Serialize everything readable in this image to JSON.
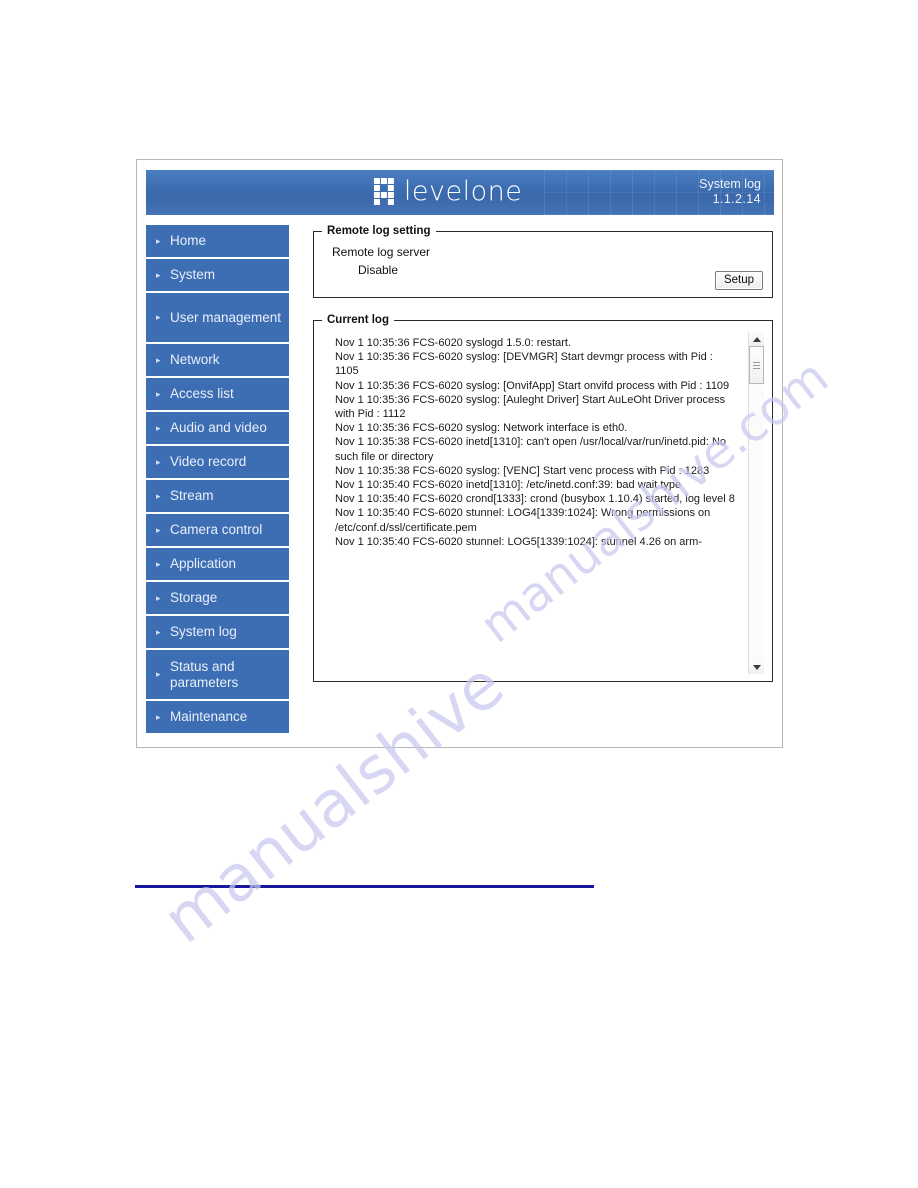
{
  "banner": {
    "logo_word": "levelone",
    "logo_icon": "levelone-grid-logo",
    "title": "System log",
    "version": "1.1.2.14"
  },
  "sidebar": {
    "items": [
      {
        "label": "Home"
      },
      {
        "label": "System"
      },
      {
        "label": "User management"
      },
      {
        "label": "Network"
      },
      {
        "label": "Access list"
      },
      {
        "label": "Audio and video"
      },
      {
        "label": "Video record"
      },
      {
        "label": "Stream"
      },
      {
        "label": "Camera control"
      },
      {
        "label": "Application"
      },
      {
        "label": "Storage"
      },
      {
        "label": "System log"
      },
      {
        "label": "Status and parameters"
      },
      {
        "label": "Maintenance"
      }
    ]
  },
  "remote_log": {
    "legend": "Remote log setting",
    "server_label": "Remote log server",
    "server_value": "Disable",
    "setup_button": "Setup"
  },
  "current_log": {
    "legend": "Current log",
    "text": "Nov 1 10:35:36 FCS-6020 syslogd 1.5.0: restart.\nNov 1 10:35:36 FCS-6020 syslog: [DEVMGR] Start devmgr process with Pid : 1105\nNov 1 10:35:36 FCS-6020 syslog: [OnvifApp] Start onvifd process with Pid : 1109\nNov 1 10:35:36 FCS-6020 syslog: [Auleght Driver] Start AuLeOht Driver process with Pid : 1112\nNov 1 10:35:36 FCS-6020 syslog: Network interface is eth0.\nNov 1 10:35:38 FCS-6020 inetd[1310]: can't open /usr/local/var/run/inetd.pid: No such file or directory\nNov 1 10:35:38 FCS-6020 syslog: [VENC] Start venc process with Pid : 1283\nNov 1 10:35:40 FCS-6020 inetd[1310]: /etc/inetd.conf:39: bad wait type\nNov 1 10:35:40 FCS-6020 crond[1333]: crond (busybox 1.10.4) started, log level 8\nNov 1 10:35:40 FCS-6020 stunnel: LOG4[1339:1024]: Wrong permissions on /etc/conf.d/ssl/certificate.pem\nNov 1 10:35:40 FCS-6020 stunnel: LOG5[1339:1024]: stunnel 4.26 on arm-",
    "scrollbar": {
      "up_arrow": "scroll-up-arrow",
      "down_arrow": "scroll-down-arrow"
    }
  },
  "watermark": {
    "line_a": "manualshive",
    "line_b": "manualshive.com"
  },
  "colors": {
    "sidebar_blue": "#3d6db3",
    "banner_blue": "#3c6cb0",
    "footer_rule": "#16179b",
    "watermark": "#c9c9ef"
  }
}
